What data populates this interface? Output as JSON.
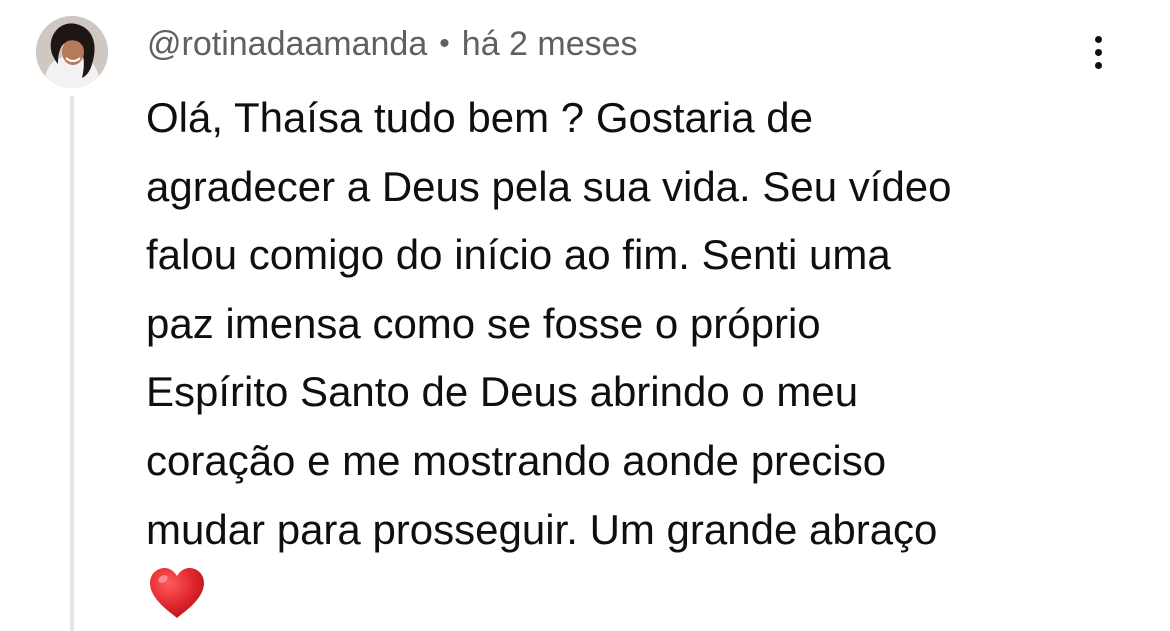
{
  "comment": {
    "username": "@rotinadaamanda",
    "separator": "•",
    "timestamp": "há 2 meses",
    "text_lines": [
      "Olá, Thaísa tudo bem ? Gostaria de",
      "agradecer a Deus pela sua vida. Seu vídeo",
      "falou comigo do início ao fim. Senti uma",
      "paz imensa como se fosse o próprio",
      "Espírito Santo de Deus abrindo o meu",
      "coração e me mostrando aonde preciso",
      "mudar para prosseguir. Um grande abraço"
    ],
    "emoji_icon": "red-heart-icon",
    "menu_icon": "more-vertical-icon"
  },
  "colors": {
    "text": "#0f0f0f",
    "meta_text": "#606060",
    "thread_line": "#e5e5e5",
    "heart": "#e0282e"
  }
}
